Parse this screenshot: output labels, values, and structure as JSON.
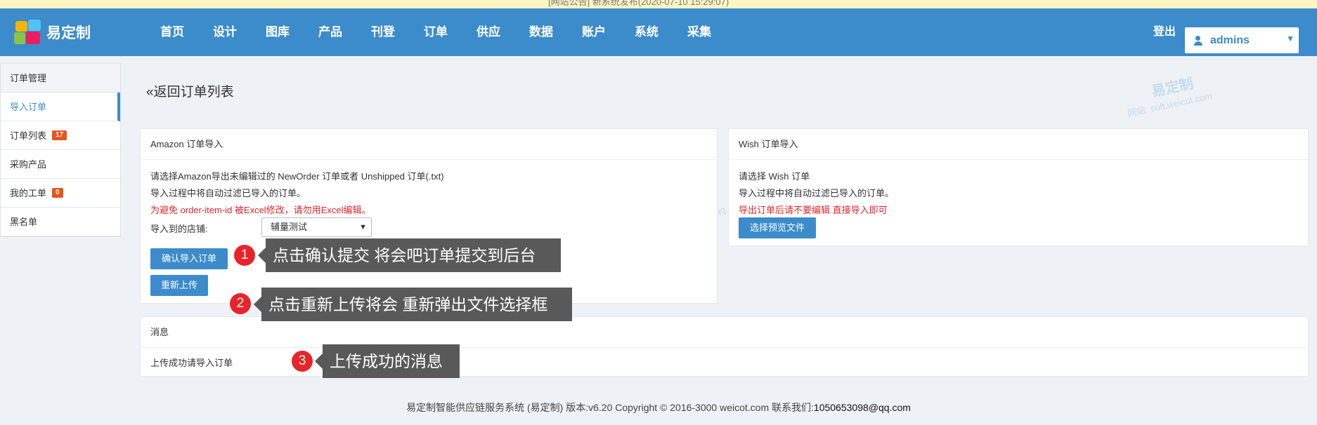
{
  "notice": "[网站公告]    新系统发布(2020-07-10 15:29:07)",
  "brand": {
    "name": "易定制",
    "colors": {
      "primary": "#3c8ccc",
      "badge": "#e8541e",
      "alert": "#e0262a"
    }
  },
  "nav": [
    "首页",
    "设计",
    "图库",
    "产品",
    "刊登",
    "订单",
    "供应",
    "数据",
    "账户",
    "系统",
    "采集"
  ],
  "header": {
    "logout": "登出",
    "user": "admins"
  },
  "sidebar": {
    "head": "订单管理",
    "items": [
      {
        "label": "导入订单"
      },
      {
        "label": "订单列表",
        "badge": "17"
      },
      {
        "label": "采购产品"
      },
      {
        "label": "我的工单",
        "badge": "0"
      },
      {
        "label": "黑名单"
      }
    ]
  },
  "back_link": "«返回订单列表",
  "amazon": {
    "title": "Amazon 订单导入",
    "line1": "请选择Amazon导出未编辑过的 NewOrder 订单或者 Unshipped 订单(.txt)",
    "line2": "导入过程中将自动过滤已导入的订单。",
    "warning": "为避免 order-item-id 被Excel修改，请勿用Excel编辑。",
    "shop_label": "导入到的店铺:",
    "shop_value": "辅量测试",
    "confirm_button": "确认导入订单",
    "reupload_button": "重新上传"
  },
  "wish": {
    "title": "Wish 订单导入",
    "line1": "请选择 Wish 订单",
    "line2": "导入过程中将自动过滤已导入的订单。",
    "warning": "导出订单后请不要编辑 直接导入即可",
    "preview_button": "选择预览文件"
  },
  "message": {
    "title": "消息",
    "text": "上传成功请导入订单"
  },
  "callouts": [
    {
      "num": "1",
      "text": "点击确认提交 将会吧订单提交到后台"
    },
    {
      "num": "2",
      "text": "点击重新上传将会 重新弹出文件选择框"
    },
    {
      "num": "3",
      "text": "上传成功的消息"
    }
  ],
  "watermark": {
    "brand": "易定制",
    "site": "网站: soft.weicot.com",
    "mail": "邮箱:1050653098@qq.com"
  },
  "footer": {
    "text": "易定制智能供应链服务系统 (易定制) 版本:v6.20 Copyright © 2016-3000 weicot.com 联系我们:",
    "contact": "1050653098@qq.com"
  }
}
